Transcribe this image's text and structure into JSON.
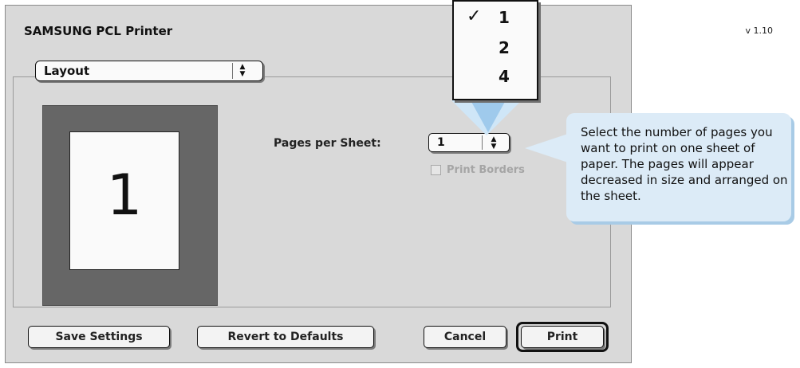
{
  "window": {
    "title": "SAMSUNG PCL Printer",
    "version": "v 1.10"
  },
  "panel_menu": {
    "selected": "Layout"
  },
  "layout_panel": {
    "preview_number": "1",
    "pages_per_sheet_label": "Pages per Sheet:",
    "pages_per_sheet_value": "1",
    "print_borders_label": "Print Borders",
    "print_borders_checked": false,
    "print_borders_enabled": false
  },
  "pages_menu": {
    "options": [
      "1",
      "2",
      "4"
    ],
    "checked_index": 0,
    "check_glyph": "✓"
  },
  "buttons": {
    "save_settings": "Save Settings",
    "revert_defaults": "Revert to Defaults",
    "cancel": "Cancel",
    "print": "Print"
  },
  "callout": {
    "text": "Select the number of pages you want to print on one sheet of paper. The pages will appear decreased in size and arranged on the sheet."
  },
  "colors": {
    "dialog_bg": "#d9d9d9",
    "preview_frame": "#666666",
    "callout_bg": "#dcebf7"
  }
}
